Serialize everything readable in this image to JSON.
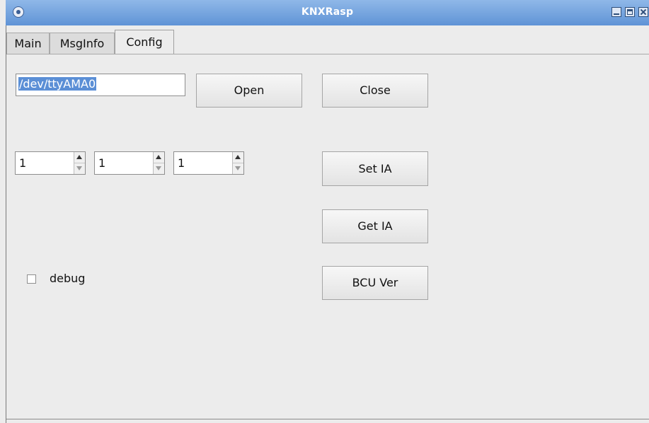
{
  "window": {
    "title": "KNXRasp"
  },
  "tabs": [
    {
      "label": "Main"
    },
    {
      "label": "MsgInfo"
    },
    {
      "label": "Config"
    }
  ],
  "config": {
    "port_value": "/dev/ttyAMA0",
    "open_label": "Open",
    "close_label": "Close",
    "ia_area": "1",
    "ia_line": "1",
    "ia_device": "1",
    "set_ia_label": "Set IA",
    "get_ia_label": "Get IA",
    "bcu_ver_label": "BCU Ver",
    "debug_label": "debug",
    "debug_checked": false
  },
  "colors": {
    "titlebar": "#6f9fde",
    "selection": "#5b8fd6",
    "background": "#ececec"
  }
}
